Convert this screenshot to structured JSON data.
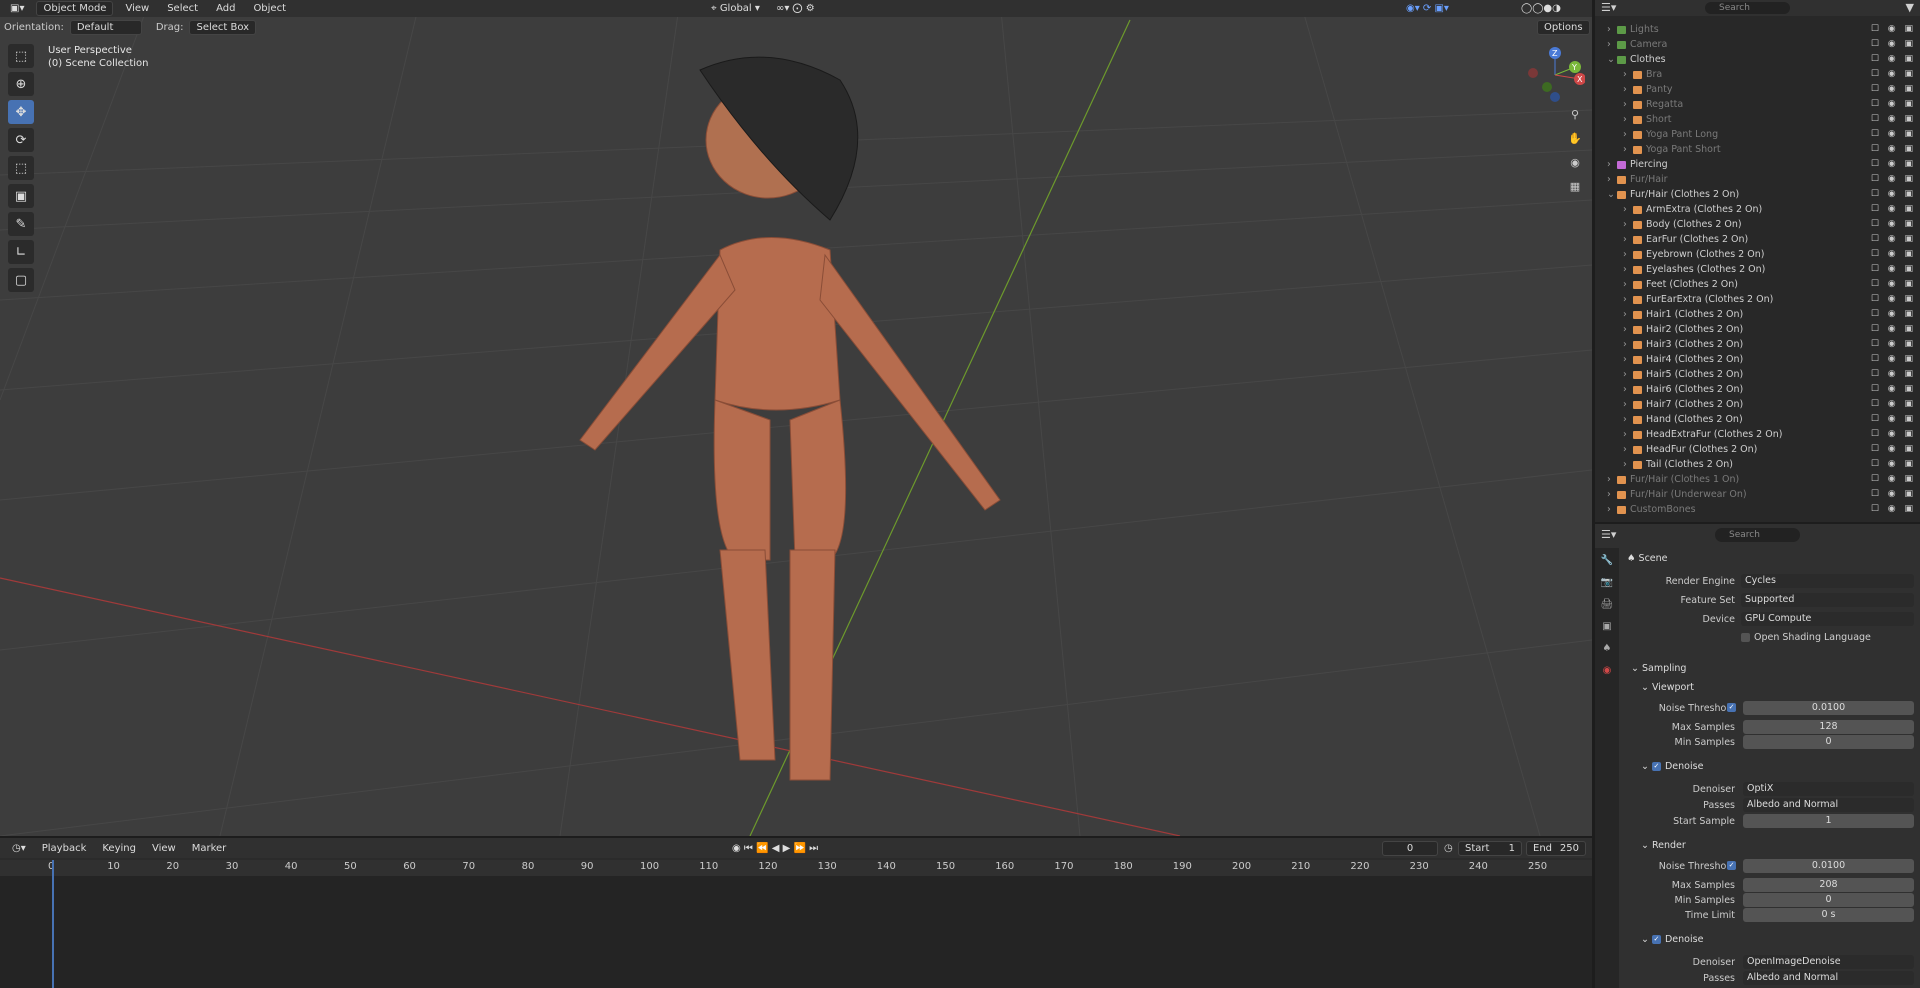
{
  "header": {
    "editor_icon": "cube-icon",
    "mode": "Object Mode",
    "menus": [
      "View",
      "Select",
      "Add",
      "Object"
    ],
    "transform_orientation": "Global",
    "options_label": "Options",
    "search_placeholder": "Search"
  },
  "tool_header": {
    "orientation_label": "Orientation:",
    "orientation_value": "Default",
    "drag_label": "Drag:",
    "drag_value": "Select Box"
  },
  "viewport": {
    "perspective": "User Perspective",
    "collection": "(0) Scene Collection",
    "gizmo_axes": [
      "Z",
      "Y",
      "X"
    ]
  },
  "toolbar": {
    "tools": [
      "select-box-icon",
      "cursor-icon",
      "move-icon",
      "rotate-icon",
      "scale-icon",
      "transform-icon",
      "annotate-icon",
      "measure-icon",
      "add-cube-icon"
    ]
  },
  "timeline": {
    "menus": [
      "Playback",
      "Keying",
      "View",
      "Marker"
    ],
    "current_frame": "0",
    "start_label": "Start",
    "start": "1",
    "end_label": "End",
    "end": "250",
    "ruler": [
      "0",
      "10",
      "20",
      "30",
      "40",
      "50",
      "60",
      "70",
      "80",
      "90",
      "100",
      "110",
      "120",
      "130",
      "140",
      "150",
      "160",
      "170",
      "180",
      "190",
      "200",
      "210",
      "220",
      "230",
      "240",
      "250"
    ]
  },
  "outliner": {
    "search_placeholder": "Search",
    "rows": [
      {
        "label": "Lights",
        "dim": true,
        "indent": 0,
        "color": "#5c9a47"
      },
      {
        "label": "Camera",
        "dim": true,
        "indent": 0,
        "color": "#5c9a47"
      },
      {
        "label": "Clothes",
        "dim": false,
        "indent": 0,
        "color": "#5c9a47",
        "expanded": true
      },
      {
        "label": "Bra",
        "dim": true,
        "indent": 1,
        "color": "#e2934f"
      },
      {
        "label": "Panty",
        "dim": true,
        "indent": 1,
        "color": "#e2934f"
      },
      {
        "label": "Regatta",
        "dim": true,
        "indent": 1,
        "color": "#e2934f"
      },
      {
        "label": "Short",
        "dim": true,
        "indent": 1,
        "color": "#e2934f"
      },
      {
        "label": "Yoga Pant Long",
        "dim": true,
        "indent": 1,
        "color": "#e2934f"
      },
      {
        "label": "Yoga Pant Short",
        "dim": true,
        "indent": 1,
        "color": "#e2934f"
      },
      {
        "label": "Piercing",
        "dim": false,
        "indent": 0,
        "color": "#c46ad6"
      },
      {
        "label": "Fur/Hair",
        "dim": true,
        "indent": 0,
        "color": "#e2934f"
      },
      {
        "label": "Fur/Hair (Clothes 2 On)",
        "dim": false,
        "indent": 0,
        "color": "#e2934f",
        "expanded": true
      },
      {
        "label": "ArmExtra (Clothes 2 On)",
        "dim": false,
        "indent": 1,
        "color": "#e2934f"
      },
      {
        "label": "Body (Clothes 2 On)",
        "dim": false,
        "indent": 1,
        "color": "#e2934f"
      },
      {
        "label": "EarFur (Clothes 2 On)",
        "dim": false,
        "indent": 1,
        "color": "#e2934f"
      },
      {
        "label": "Eyebrown (Clothes 2 On)",
        "dim": false,
        "indent": 1,
        "color": "#e2934f"
      },
      {
        "label": "Eyelashes (Clothes 2 On)",
        "dim": false,
        "indent": 1,
        "color": "#e2934f"
      },
      {
        "label": "Feet (Clothes 2 On)",
        "dim": false,
        "indent": 1,
        "color": "#e2934f"
      },
      {
        "label": "FurEarExtra (Clothes 2 On)",
        "dim": false,
        "indent": 1,
        "color": "#e2934f"
      },
      {
        "label": "Hair1 (Clothes 2 On)",
        "dim": false,
        "indent": 1,
        "color": "#e2934f"
      },
      {
        "label": "Hair2 (Clothes 2 On)",
        "dim": false,
        "indent": 1,
        "color": "#e2934f"
      },
      {
        "label": "Hair3 (Clothes 2 On)",
        "dim": false,
        "indent": 1,
        "color": "#e2934f"
      },
      {
        "label": "Hair4 (Clothes 2 On)",
        "dim": false,
        "indent": 1,
        "color": "#e2934f"
      },
      {
        "label": "Hair5 (Clothes 2 On)",
        "dim": false,
        "indent": 1,
        "color": "#e2934f"
      },
      {
        "label": "Hair6 (Clothes 2 On)",
        "dim": false,
        "indent": 1,
        "color": "#e2934f"
      },
      {
        "label": "Hair7 (Clothes 2 On)",
        "dim": false,
        "indent": 1,
        "color": "#e2934f"
      },
      {
        "label": "Hand (Clothes 2 On)",
        "dim": false,
        "indent": 1,
        "color": "#e2934f"
      },
      {
        "label": "HeadExtraFur (Clothes 2 On)",
        "dim": false,
        "indent": 1,
        "color": "#e2934f"
      },
      {
        "label": "HeadFur (Clothes 2 On)",
        "dim": false,
        "indent": 1,
        "color": "#e2934f"
      },
      {
        "label": "Tail (Clothes 2 On)",
        "dim": false,
        "indent": 1,
        "color": "#e2934f"
      },
      {
        "label": "Fur/Hair (Clothes 1 On)",
        "dim": true,
        "indent": 0,
        "color": "#e2934f"
      },
      {
        "label": "Fur/Hair (Underwear On)",
        "dim": true,
        "indent": 0,
        "color": "#e2934f"
      },
      {
        "label": "CustomBones",
        "dim": true,
        "indent": 0,
        "color": "#e2934f"
      }
    ]
  },
  "properties": {
    "search_placeholder": "Search",
    "context": "Scene",
    "render_engine_label": "Render Engine",
    "render_engine": "Cycles",
    "feature_set_label": "Feature Set",
    "feature_set": "Supported",
    "device_label": "Device",
    "device": "GPU Compute",
    "osl_label": "Open Shading Language",
    "sampling_label": "Sampling",
    "viewport_label": "Viewport",
    "vp_noise_label": "Noise Threshold",
    "vp_noise": "0.0100",
    "vp_max_label": "Max Samples",
    "vp_max": "128",
    "vp_min_label": "Min Samples",
    "vp_min": "0",
    "vp_denoise_label": "Denoise",
    "vp_denoiser_label": "Denoiser",
    "vp_denoiser": "OptiX",
    "vp_passes_label": "Passes",
    "vp_passes": "Albedo and Normal",
    "vp_start_label": "Start Sample",
    "vp_start": "1",
    "render_label": "Render",
    "r_noise_label": "Noise Threshold",
    "r_noise": "0.0100",
    "r_max_label": "Max Samples",
    "r_max": "208",
    "r_min_label": "Min Samples",
    "r_min": "0",
    "r_time_label": "Time Limit",
    "r_time": "0 s",
    "r_denoise_label": "Denoise",
    "r_denoiser_label": "Denoiser",
    "r_denoiser": "OpenImageDenoise",
    "r_passes_label": "Passes",
    "r_passes": "Albedo and Normal"
  }
}
